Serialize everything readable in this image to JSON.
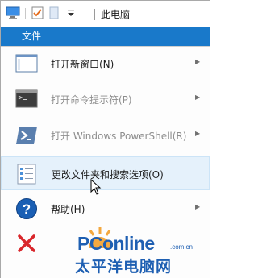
{
  "window": {
    "title": "此电脑"
  },
  "ribbon": {
    "file_tab": "文件"
  },
  "menu": {
    "items": [
      {
        "label": "打开新窗口(N)",
        "icon": "new-window-icon",
        "has_submenu": true,
        "enabled": true
      },
      {
        "label": "打开命令提示符(P)",
        "icon": "command-prompt-icon",
        "has_submenu": true,
        "enabled": false
      },
      {
        "label": "打开 Windows PowerShell(R)",
        "icon": "powershell-icon",
        "has_submenu": true,
        "enabled": false
      },
      {
        "label": "更改文件夹和搜索选项(O)",
        "icon": "folder-options-icon",
        "has_submenu": false,
        "enabled": true,
        "hovered": true
      },
      {
        "label": "帮助(H)",
        "icon": "help-icon",
        "has_submenu": true,
        "enabled": true
      },
      {
        "label": "",
        "icon": "close-icon",
        "has_submenu": false,
        "enabled": true
      }
    ],
    "submenu_arrow": "▶"
  },
  "watermark": {
    "brand": "PConline",
    "domain": ".com.cn",
    "chinese": "太平洋电脑网"
  },
  "colors": {
    "accent": "#1979ca",
    "hover_bg": "#e5f1fb",
    "close_red": "#d9262b",
    "help_blue": "#1a5fb4"
  }
}
